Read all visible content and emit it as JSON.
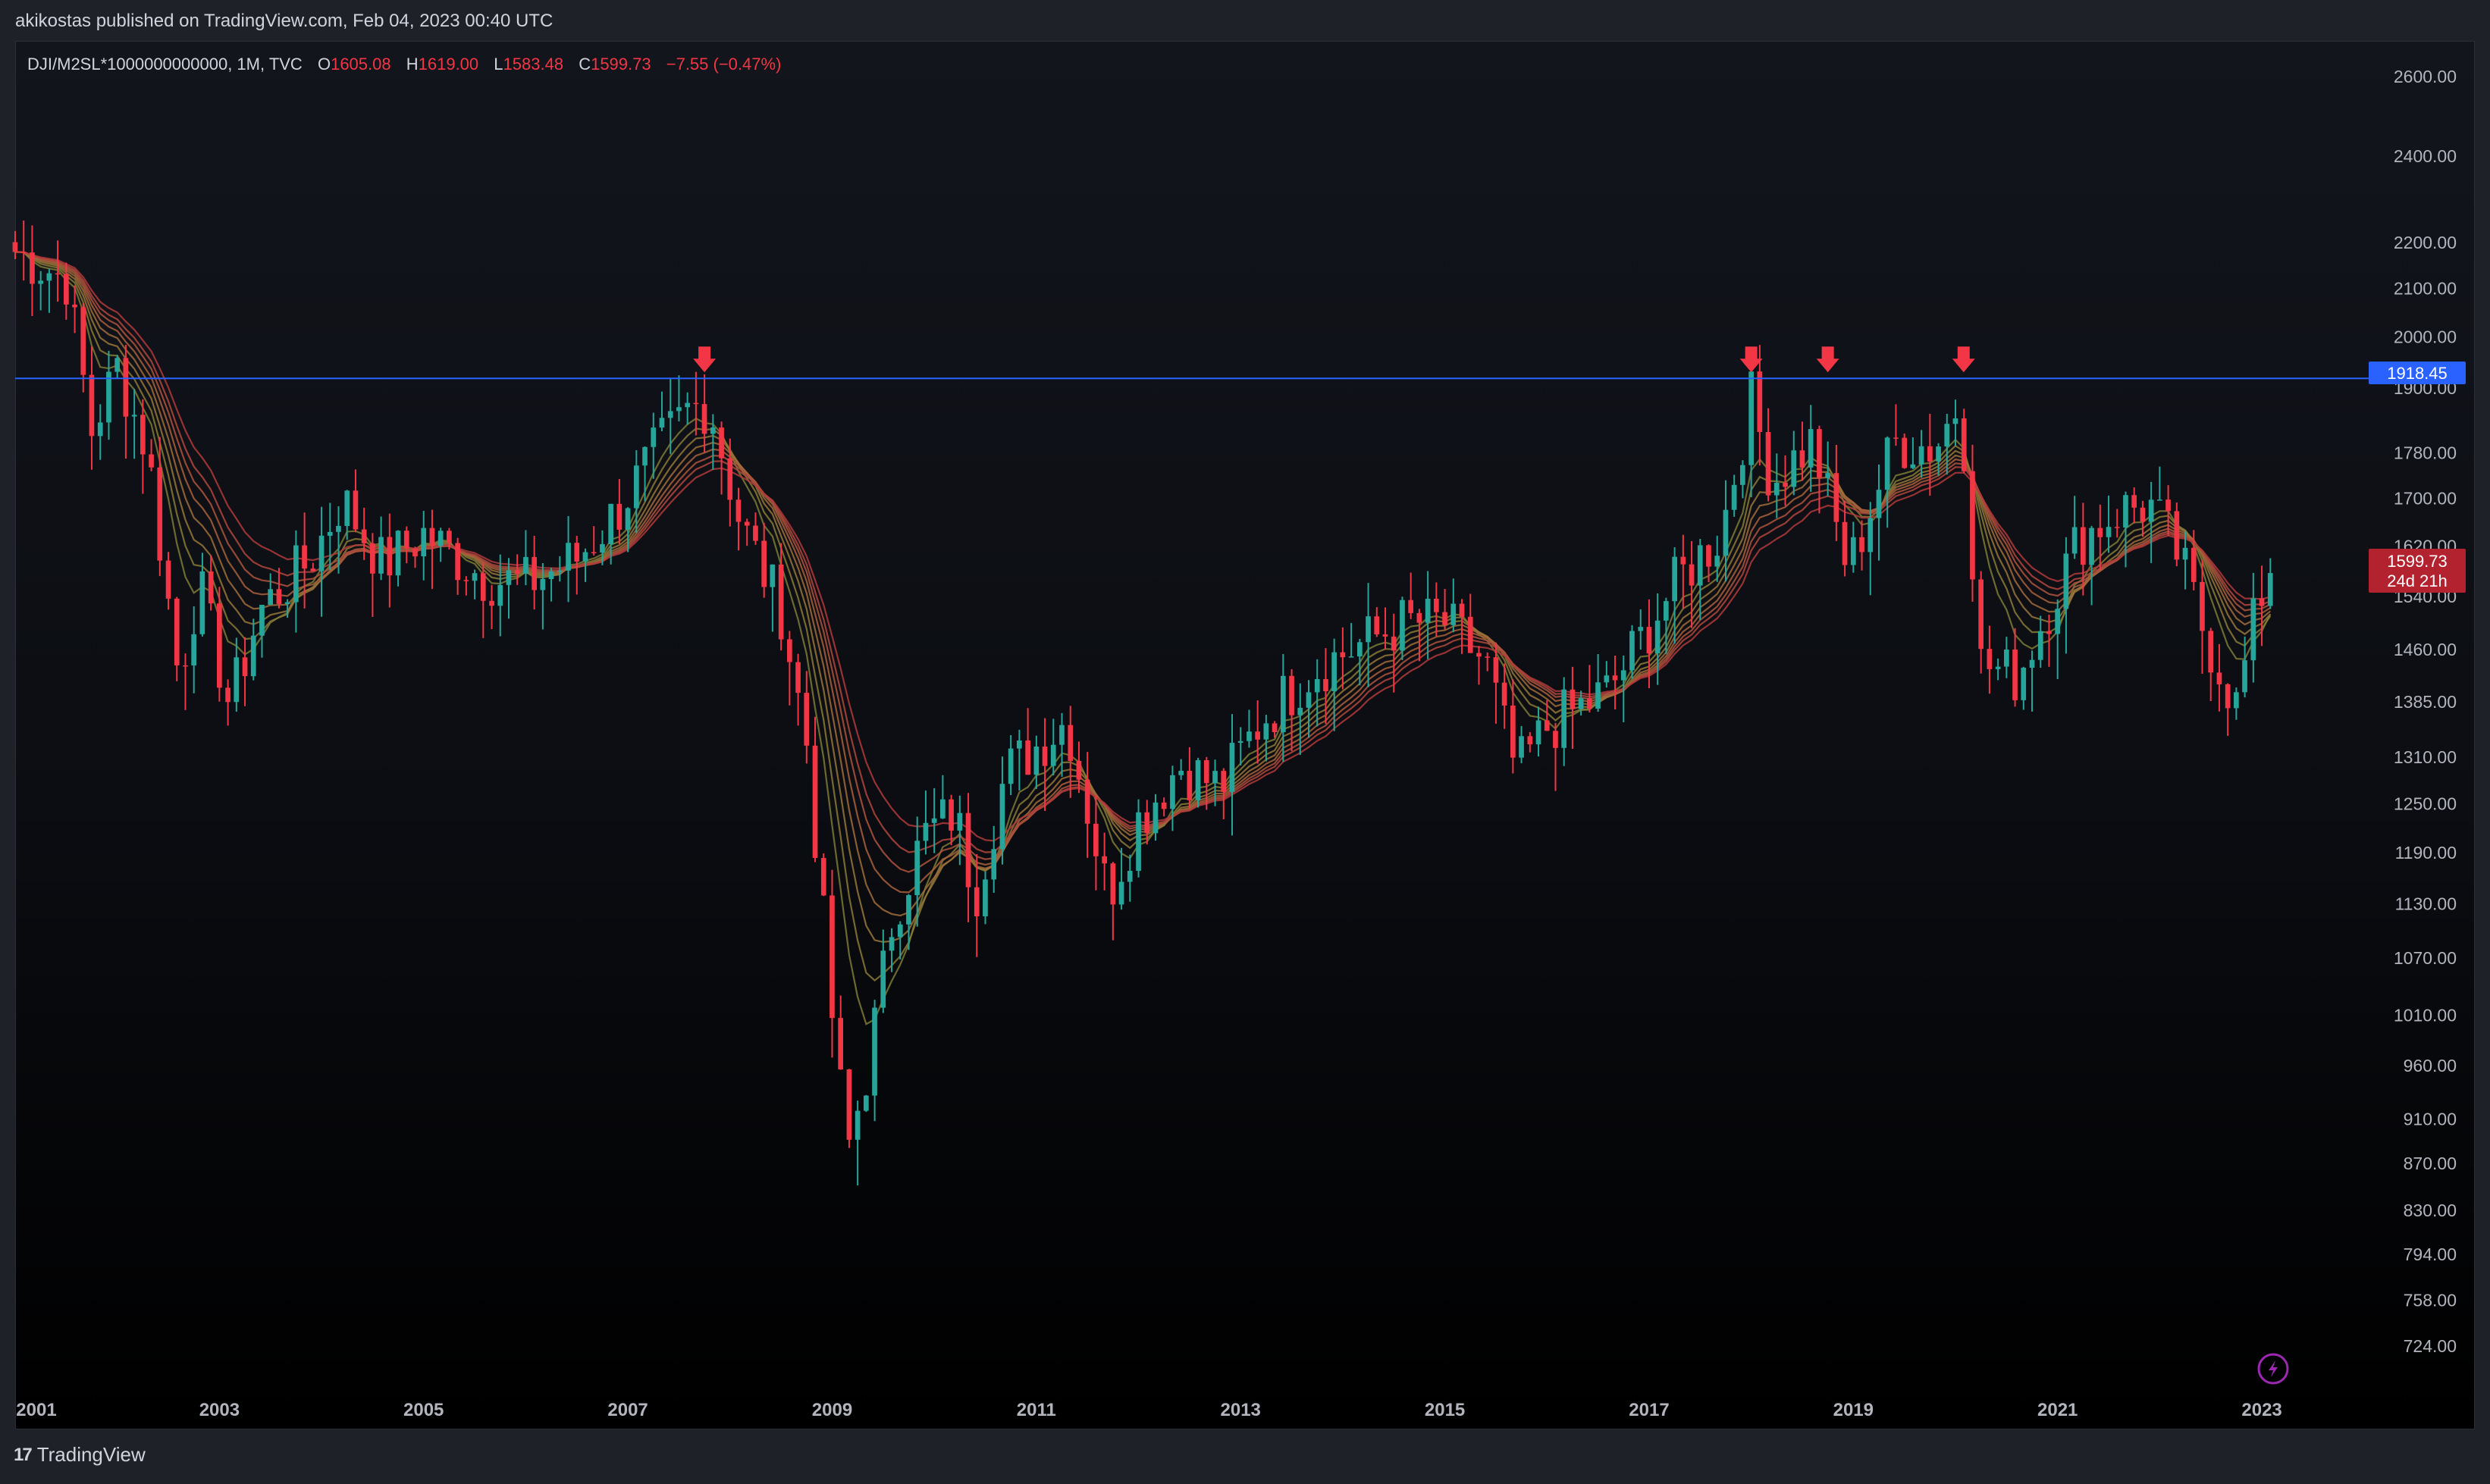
{
  "header": {
    "publisher_line": "akikostas published on TradingView.com, Feb 04, 2023 00:40 UTC"
  },
  "legend": {
    "symbol": "DJI/M2SL*1000000000000, 1M, TVC",
    "open_label": "O",
    "open": "1605.08",
    "high_label": "H",
    "high": "1619.00",
    "low_label": "L",
    "low": "1583.48",
    "close_label": "C",
    "close": "1599.73",
    "change": "−7.55 (−0.47%)"
  },
  "price_tags": {
    "horizontal_line": "1918.45",
    "last_price": "1599.73",
    "countdown": "24d 21h"
  },
  "footer": {
    "brand": "TradingView"
  },
  "colors": {
    "up": "#26a69a",
    "down": "#f23645",
    "hline": "#2962ff",
    "ribbon_fast": "#8c8c3c",
    "ribbon_slow": "#b03a3a",
    "arrow": "#f23645",
    "last_tag": "#b2222f"
  },
  "icons": {
    "bolt": "lightning-bolt-icon",
    "arrow": "down-arrow-icon"
  },
  "chart_data": {
    "type": "candlestick",
    "scale": "log",
    "ylim": [
      700,
      2650
    ],
    "xlim": [
      2001.0,
      2023.2
    ],
    "y_ticks": [
      "2600.00",
      "2400.00",
      "2200.00",
      "2100.00",
      "2000.00",
      "1900.00",
      "1780.00",
      "1700.00",
      "1620.00",
      "1540.00",
      "1460.00",
      "1385.00",
      "1310.00",
      "1250.00",
      "1190.00",
      "1130.00",
      "1070.00",
      "1010.00",
      "960.00",
      "910.00",
      "870.00",
      "830.00",
      "794.00",
      "758.00",
      "724.00"
    ],
    "x_ticks": [
      "2001",
      "2003",
      "2005",
      "2007",
      "2009",
      "2011",
      "2013",
      "2015",
      "2017",
      "2019",
      "2021",
      "2023"
    ],
    "horizontal_line": 1918.45,
    "signal_arrows": [
      2007.75,
      2018.0,
      2018.75,
      2020.08
    ],
    "anchors": [
      [
        2001.0,
        2180
      ],
      [
        2001.5,
        2120
      ],
      [
        2001.75,
        1820
      ],
      [
        2002.0,
        1940
      ],
      [
        2002.3,
        1780
      ],
      [
        2002.6,
        1420
      ],
      [
        2002.8,
        1560
      ],
      [
        2003.1,
        1380
      ],
      [
        2003.4,
        1520
      ],
      [
        2003.9,
        1600
      ],
      [
        2004.2,
        1700
      ],
      [
        2004.6,
        1590
      ],
      [
        2005.0,
        1640
      ],
      [
        2005.6,
        1570
      ],
      [
        2006.0,
        1560
      ],
      [
        2006.5,
        1600
      ],
      [
        2006.9,
        1680
      ],
      [
        2007.3,
        1790
      ],
      [
        2007.6,
        1860
      ],
      [
        2007.8,
        1870
      ],
      [
        2008.1,
        1660
      ],
      [
        2008.5,
        1520
      ],
      [
        2008.75,
        1330
      ],
      [
        2009.0,
        1010
      ],
      [
        2009.15,
        880
      ],
      [
        2009.35,
        960
      ],
      [
        2009.6,
        1120
      ],
      [
        2009.9,
        1210
      ],
      [
        2010.2,
        1240
      ],
      [
        2010.4,
        1140
      ],
      [
        2010.7,
        1290
      ],
      [
        2011.3,
        1360
      ],
      [
        2011.7,
        1140
      ],
      [
        2012.0,
        1230
      ],
      [
        2012.4,
        1300
      ],
      [
        2012.8,
        1270
      ],
      [
        2013.2,
        1360
      ],
      [
        2013.7,
        1430
      ],
      [
        2014.2,
        1470
      ],
      [
        2014.6,
        1500
      ],
      [
        2015.0,
        1500
      ],
      [
        2015.4,
        1440
      ],
      [
        2015.7,
        1290
      ],
      [
        2016.0,
        1350
      ],
      [
        2016.6,
        1400
      ],
      [
        2016.9,
        1470
      ],
      [
        2017.3,
        1570
      ],
      [
        2017.7,
        1640
      ],
      [
        2018.0,
        1880
      ],
      [
        2018.2,
        1730
      ],
      [
        2018.6,
        1800
      ],
      [
        2018.95,
        1580
      ],
      [
        2019.4,
        1800
      ],
      [
        2019.8,
        1790
      ],
      [
        2020.05,
        1880
      ],
      [
        2020.25,
        1440
      ],
      [
        2020.6,
        1420
      ],
      [
        2020.9,
        1520
      ],
      [
        2021.2,
        1630
      ],
      [
        2021.6,
        1680
      ],
      [
        2021.9,
        1690
      ],
      [
        2022.2,
        1600
      ],
      [
        2022.45,
        1480
      ],
      [
        2022.75,
        1380
      ],
      [
        2022.95,
        1520
      ],
      [
        2023.1,
        1600
      ]
    ]
  }
}
